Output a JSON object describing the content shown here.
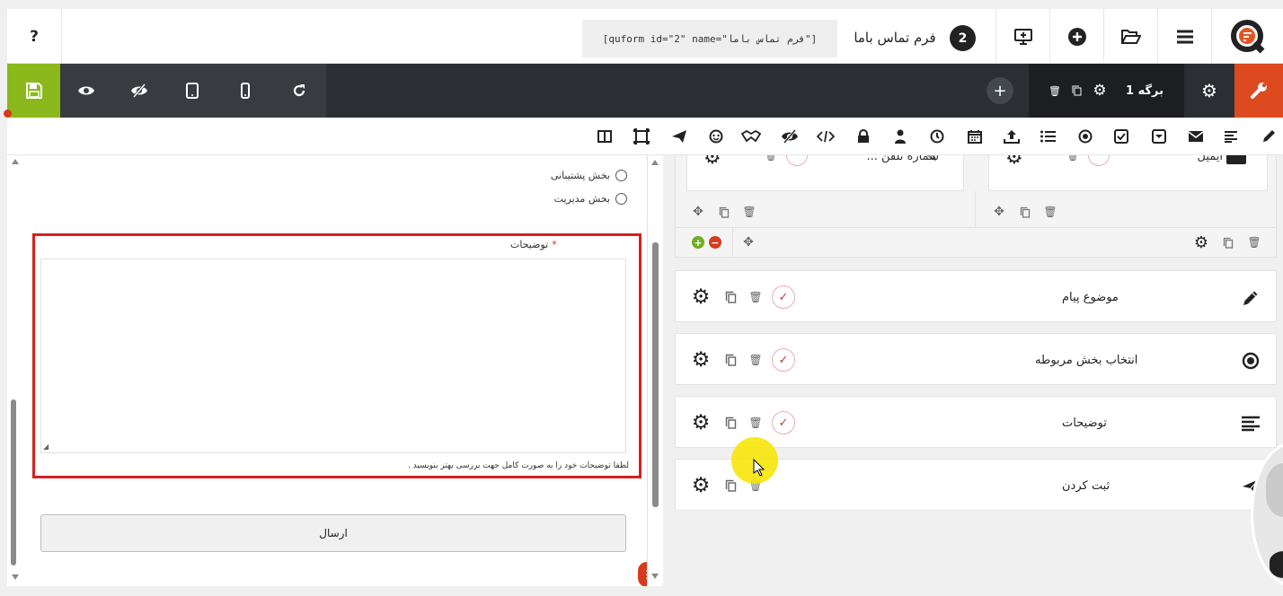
{
  "header": {
    "help_label": "?",
    "shortcode": "[quform id=\"2\" name=\"فرم تماس باما\"]",
    "form_number": "2",
    "form_title": "فرم تماس باما"
  },
  "toolbar": {
    "page_label": "برگه 1"
  },
  "preview": {
    "radio_options": [
      "بخش پشتیبانی",
      "بخش مدیریت"
    ],
    "textarea_label": "توضیحات",
    "required_mark": "*",
    "textarea_help": "لطفا توضیحات خود را به صورت کامل جهت بررسی بهتر بنویسید .",
    "submit_label": "ارسال"
  },
  "builder": {
    "top_fields": [
      "شماره تلفن ...",
      "ایمیل"
    ],
    "elements": [
      {
        "label": "موضوع پیام",
        "icon": "pencil-icon"
      },
      {
        "label": "انتخاب بخش مربوطه",
        "icon": "radio-icon"
      },
      {
        "label": "توضیحات",
        "icon": "paragraph-icon"
      },
      {
        "label": "ثبت کردن",
        "icon": "send-icon"
      }
    ]
  },
  "colors": {
    "save_green": "#8bb81a",
    "settings_orange": "#dd4a1f",
    "toolbar_dark": "#2b2f33",
    "highlight_red": "#d62020",
    "cursor_yellow": "#f7e60a"
  }
}
